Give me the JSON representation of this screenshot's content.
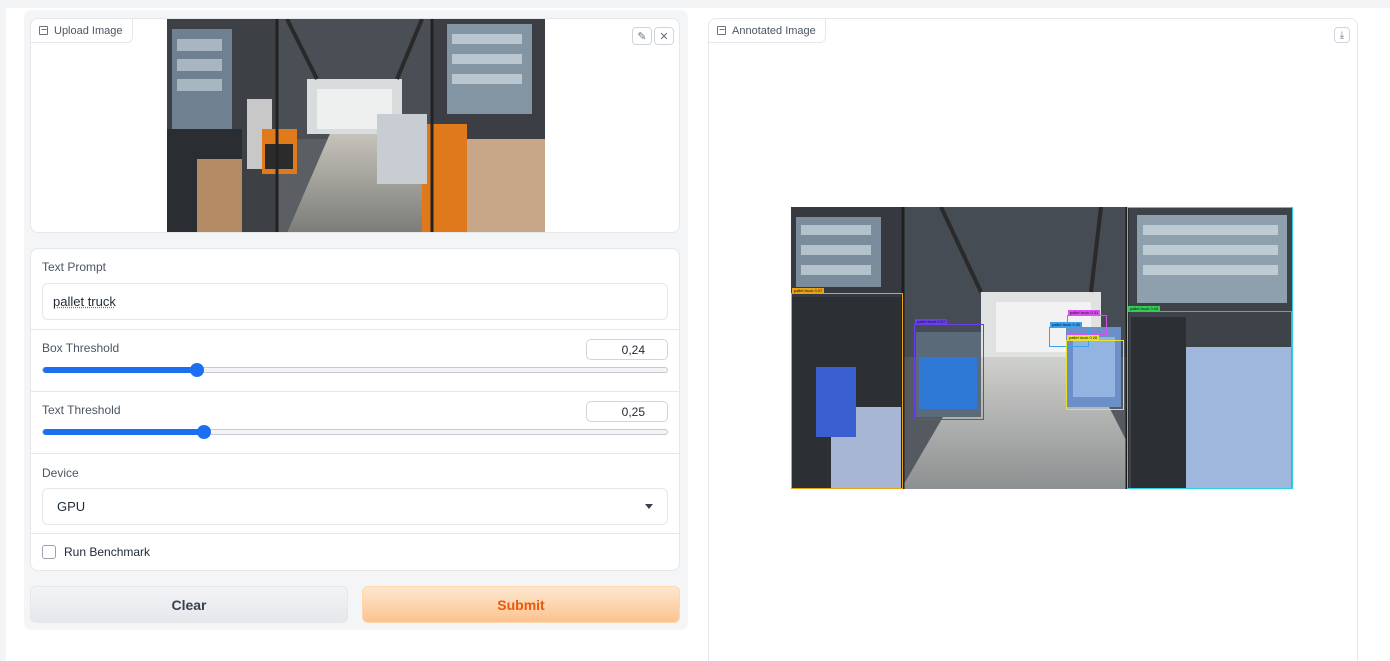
{
  "upload": {
    "label": "Upload Image",
    "label_icon": "image-icon",
    "edit_icon": "pencil-icon",
    "clear_icon": "close-icon"
  },
  "prompt": {
    "label": "Text Prompt",
    "value": "pallet truck"
  },
  "box_threshold": {
    "label": "Box Threshold",
    "value": "0,24",
    "level": 0.24
  },
  "text_threshold": {
    "label": "Text Threshold",
    "value": "0,25",
    "level": 0.25
  },
  "device": {
    "label": "Device",
    "selected": "GPU"
  },
  "benchmark": {
    "label": "Run Benchmark",
    "checked": false
  },
  "buttons": {
    "clear": "Clear",
    "submit": "Submit"
  },
  "annotated": {
    "label": "Annotated Image",
    "label_icon": "image-icon",
    "download_icon": "download-icon"
  },
  "colors": {
    "accent": "#1d6ff2",
    "submit_text": "#ea580c",
    "submit_bg": "#fcc38f"
  },
  "detections": [
    {
      "label": "pallet truck 0.37",
      "color": "#e8a317"
    },
    {
      "label": "pallet truck 0.27",
      "color": "#6a3df0"
    },
    {
      "label": "pallet truck 0.31",
      "color": "#d94ef0"
    },
    {
      "label": "pallet truck 0.30",
      "color": "#3aa0f0"
    },
    {
      "label": "pallet truck 0.26",
      "color": "#e6e22e"
    },
    {
      "label": "pallet truck 0.43",
      "color": "#33cc55"
    },
    {
      "label": "",
      "color": "#2ed1e0"
    }
  ]
}
